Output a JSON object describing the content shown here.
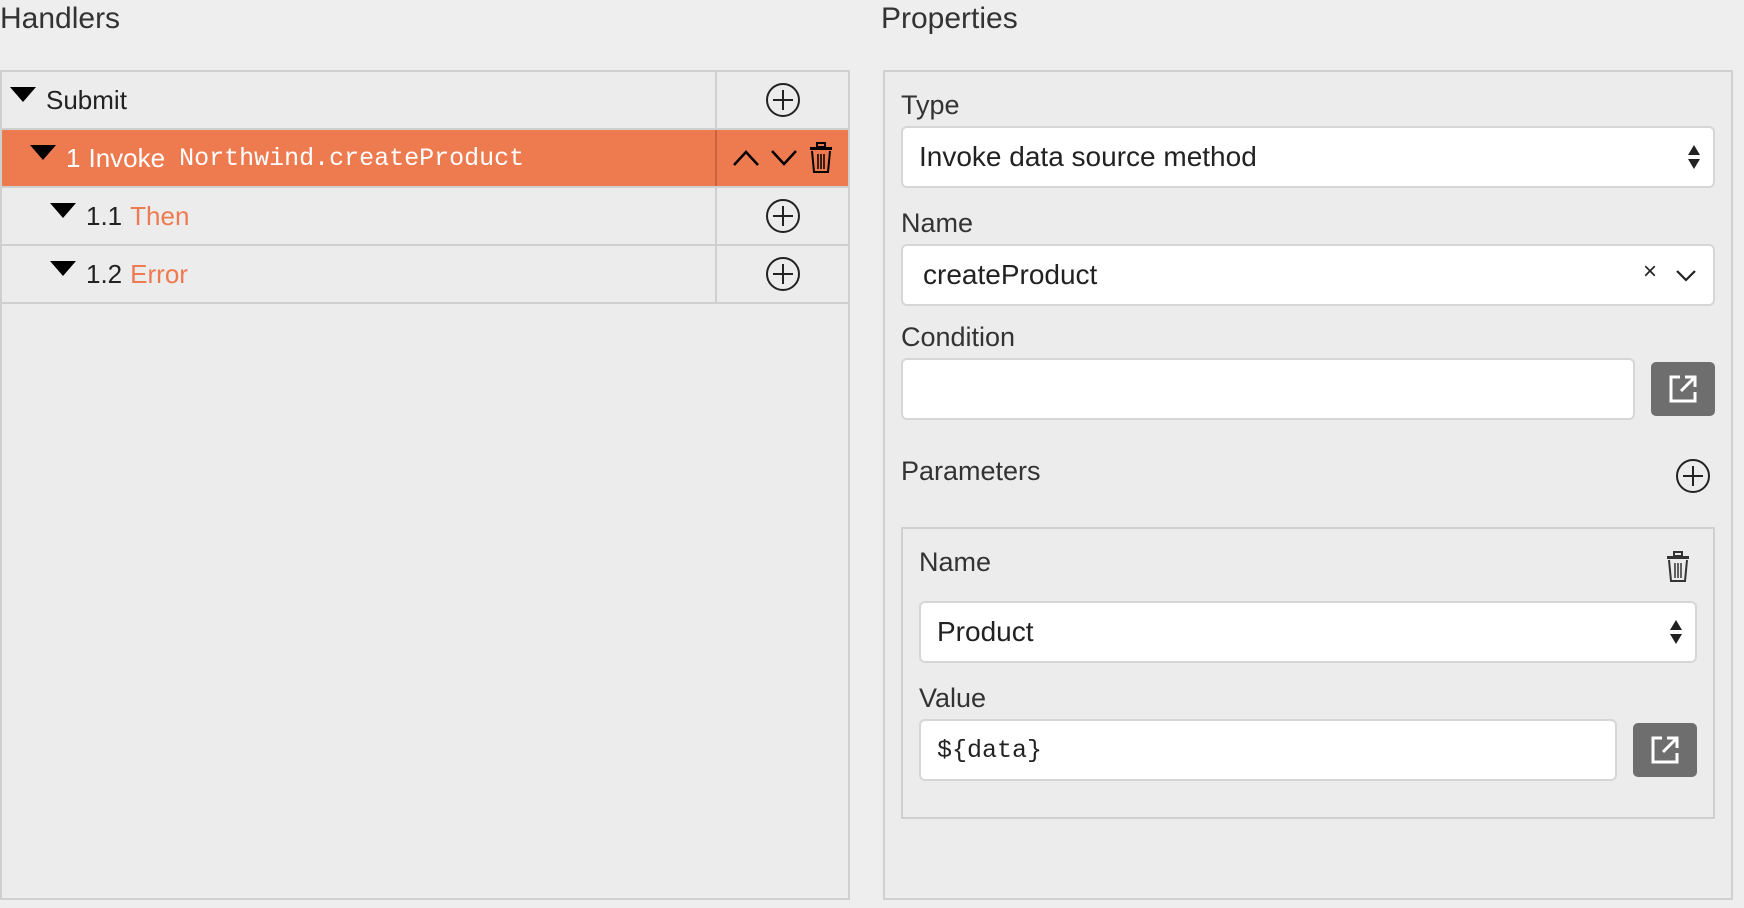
{
  "handlers": {
    "title": "Handlers",
    "rows": [
      {
        "label": "Submit"
      },
      {
        "num": "1",
        "text": "Invoke",
        "code": "Northwind.createProduct"
      },
      {
        "num": "1.1",
        "text": "Then"
      },
      {
        "num": "1.2",
        "text": "Error"
      }
    ]
  },
  "properties": {
    "title": "Properties",
    "type_label": "Type",
    "type_value": "Invoke data source method",
    "name_label": "Name",
    "name_value": "createProduct",
    "clear_symbol": "×",
    "condition_label": "Condition",
    "condition_value": "",
    "parameters_label": "Parameters",
    "param": {
      "name_label": "Name",
      "name_value": "Product",
      "value_label": "Value",
      "value_value": "${data}"
    }
  },
  "colors": {
    "accent": "#ee7a50",
    "background": "#eeeeee",
    "button_gray": "#6e6e6e"
  },
  "icons": [
    "plus-circle-icon",
    "chevron-up-icon",
    "chevron-down-icon",
    "trash-icon",
    "external-edit-icon",
    "caret-down-icon",
    "updown-icon",
    "clear-icon"
  ]
}
